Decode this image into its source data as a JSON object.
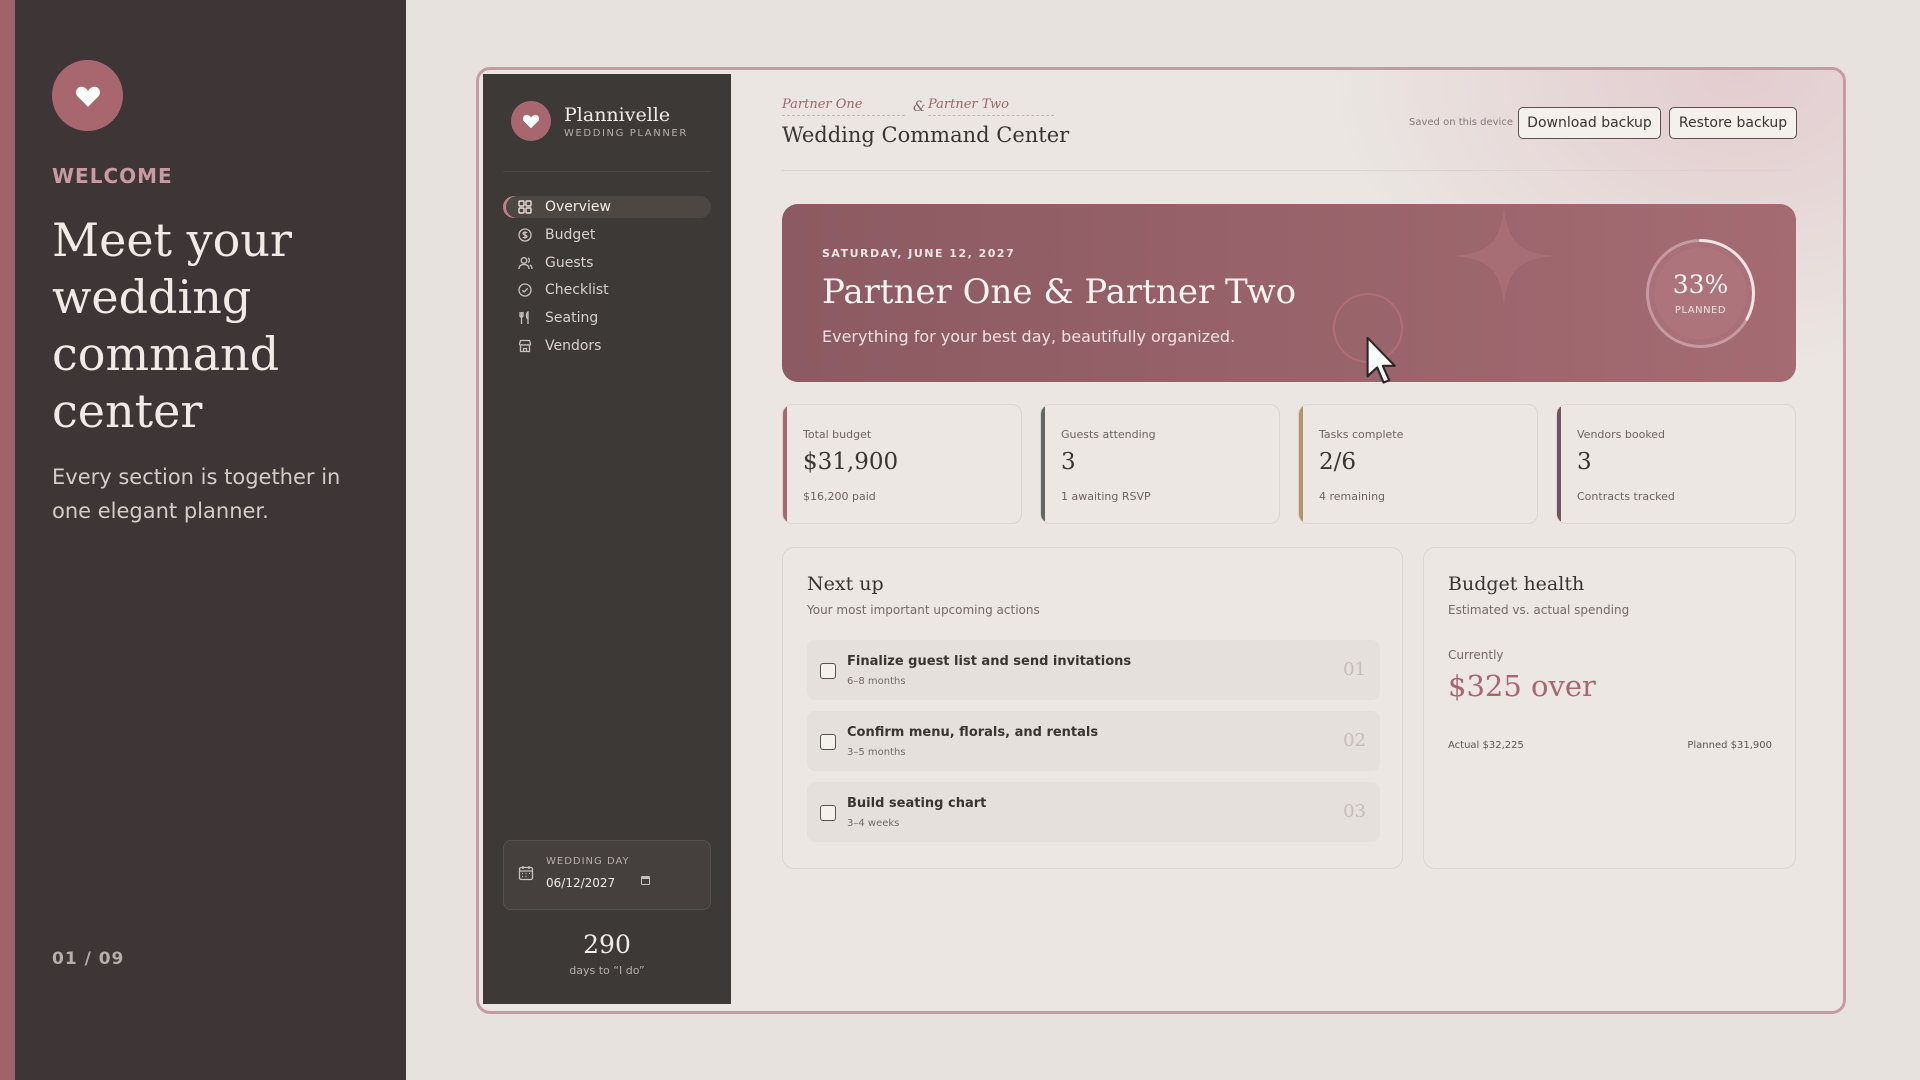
{
  "welcome": {
    "label": "WELCOME",
    "title": "Meet your wedding command center",
    "subtitle": "Every section is together in one elegant planner.",
    "page": "01 / 09"
  },
  "brand": {
    "name": "Plannivelle",
    "tagline": "WEDDING PLANNER"
  },
  "nav": {
    "items": [
      {
        "label": "Overview",
        "icon": "grid-icon",
        "active": true
      },
      {
        "label": "Budget",
        "icon": "dollar-icon"
      },
      {
        "label": "Guests",
        "icon": "users-icon"
      },
      {
        "label": "Checklist",
        "icon": "check-circle-icon"
      },
      {
        "label": "Seating",
        "icon": "utensils-icon"
      },
      {
        "label": "Vendors",
        "icon": "store-icon"
      }
    ]
  },
  "wedding_day": {
    "label": "WEDDING DAY",
    "value": "06/12/2027",
    "days_count": "290",
    "days_label": "days to “I do”"
  },
  "header": {
    "partner_one": "Partner One",
    "ampersand": "&",
    "partner_two": "Partner Two",
    "title": "Wedding Command Center",
    "saved_text": "Saved on this device",
    "download_label": "Download backup",
    "restore_label": "Restore backup"
  },
  "hero": {
    "date": "SATURDAY, JUNE 12, 2027",
    "names": "Partner One & Partner Two",
    "subtitle": "Everything for your best day, beautifully organized.",
    "progress_value": 0.33,
    "progress_text": "33%",
    "progress_label": "PLANNED"
  },
  "stats": [
    {
      "label": "Total budget",
      "value": "$31,900",
      "sub": "$16,200 paid",
      "accent": "#a8676f"
    },
    {
      "label": "Guests attending",
      "value": "3",
      "sub": "1 awaiting RSVP",
      "accent": "#5e6867"
    },
    {
      "label": "Tasks complete",
      "value": "2/6",
      "sub": "4 remaining",
      "accent": "#b49668"
    },
    {
      "label": "Vendors booked",
      "value": "3",
      "sub": "Contracts tracked",
      "accent": "#6d5463"
    }
  ],
  "next_up": {
    "title": "Next up",
    "subtitle": "Your most important upcoming actions",
    "tasks": [
      {
        "title": "Finalize guest list and send invitations",
        "time": "6–8 months",
        "num": "01"
      },
      {
        "title": "Confirm menu, florals, and rentals",
        "time": "3–5 months",
        "num": "02"
      },
      {
        "title": "Build seating chart",
        "time": "3–4 weeks",
        "num": "03"
      }
    ]
  },
  "budget_health": {
    "title": "Budget health",
    "subtitle": "Estimated vs. actual spending",
    "currently": "Currently",
    "over": "$325 over",
    "actual": "Actual $32,225",
    "planned": "Planned $31,900"
  },
  "colors": {
    "accent": "#a8676f",
    "sidebar": "#3d3937",
    "background": "#e8e2de"
  }
}
